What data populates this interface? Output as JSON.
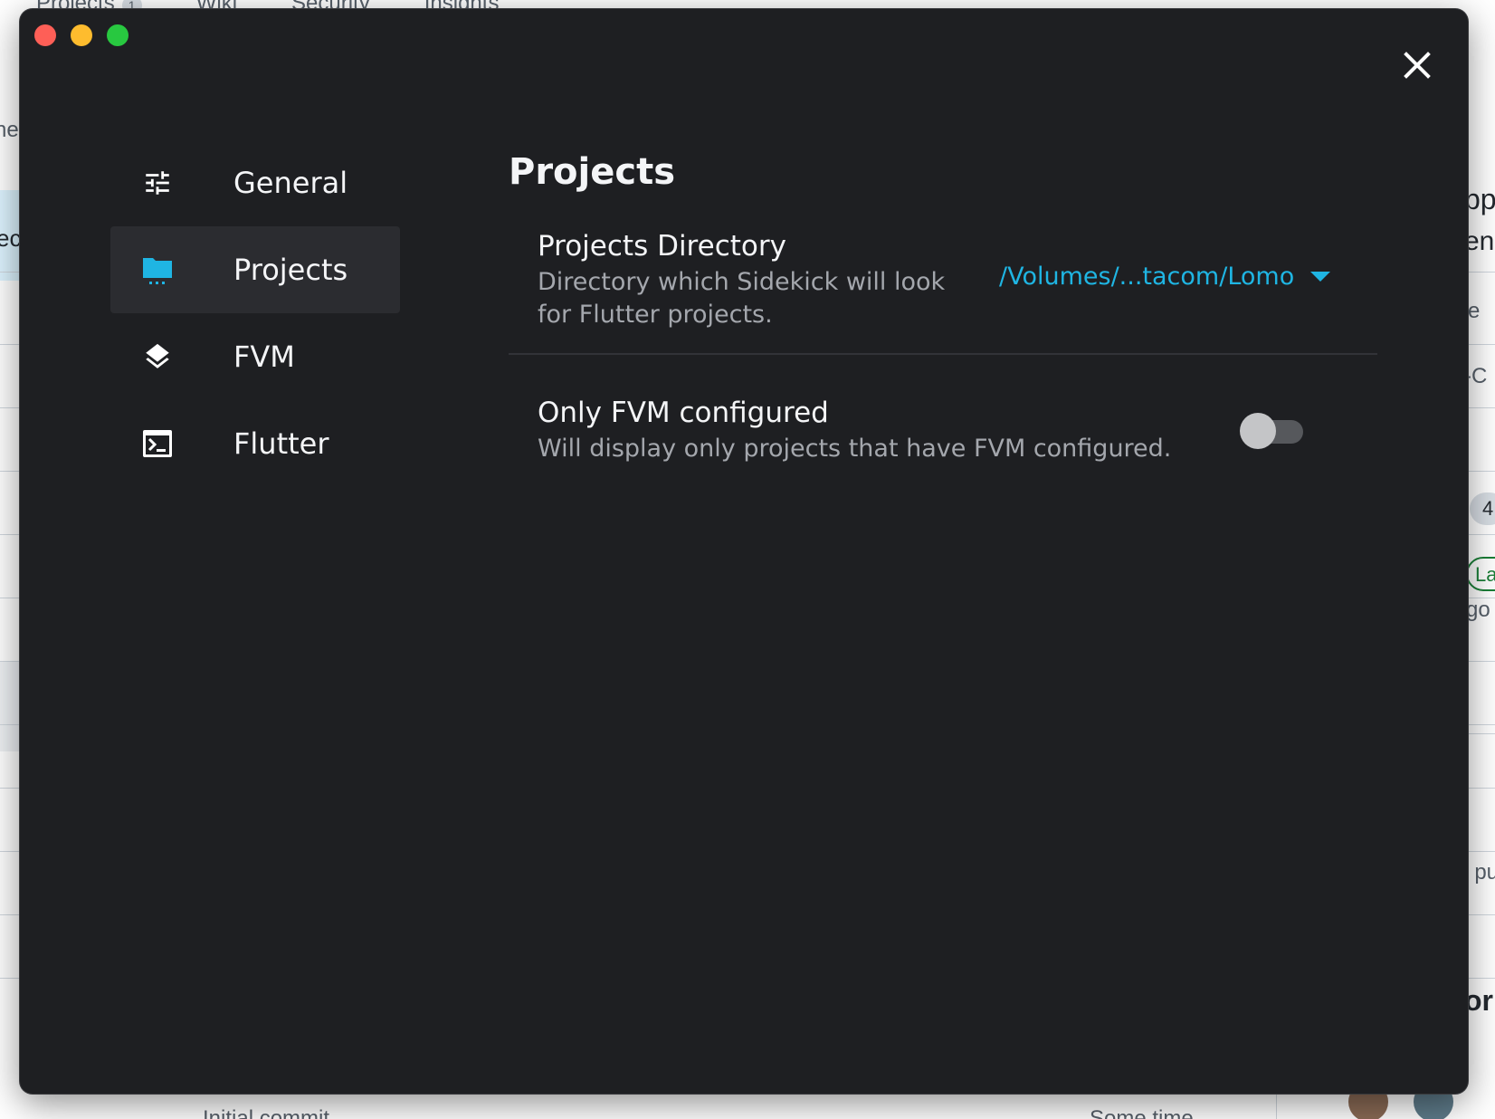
{
  "background": {
    "nav_tabs": [
      "Projects",
      "Wiki",
      "Security",
      "Insights"
    ],
    "projects_count": "1",
    "fragments": {
      "left_1": "ne",
      "left_2": "ec",
      "right_1": "pp",
      "right_2": "en",
      "right_3": "e",
      "right_4": "-C",
      "right_badge": "4",
      "right_label": "La",
      "right_ago": "go",
      "right_pu": ". pu",
      "right_bold": "or",
      "bottom_left": "Initial commit",
      "bottom_right": "Some time"
    }
  },
  "window": {
    "close_icon": "close-icon",
    "sidebar": {
      "items": [
        {
          "label": "General",
          "icon": "sliders-icon",
          "active": false
        },
        {
          "label": "Projects",
          "icon": "folder-icon",
          "active": true
        },
        {
          "label": "FVM",
          "icon": "layers-icon",
          "active": false
        },
        {
          "label": "Flutter",
          "icon": "terminal-icon",
          "active": false
        }
      ]
    },
    "content": {
      "title": "Projects",
      "projects_directory": {
        "title": "Projects Directory",
        "description": "Directory which Sidekick will look for Flutter projects.",
        "value": "/Volumes/...tacom/Lomo"
      },
      "only_fvm": {
        "title": "Only FVM configured",
        "description": "Will display only projects that have FVM configured.",
        "enabled": false
      }
    },
    "colors": {
      "background": "#1e1f22",
      "accent": "#1fb5e3",
      "active_item": "#2b2c30"
    }
  }
}
